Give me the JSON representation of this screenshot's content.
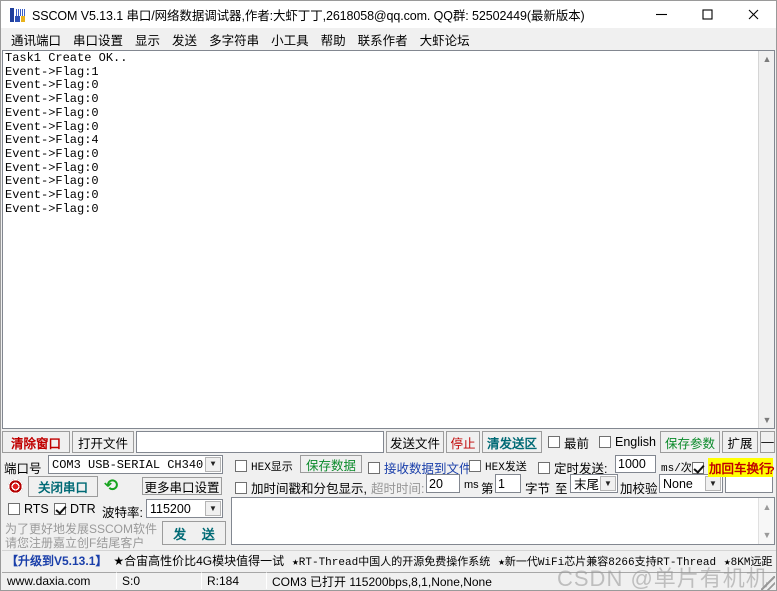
{
  "window": {
    "title": "SSCOM V5.13.1 串口/网络数据调试器,作者:大虾丁丁,2618058@qq.com. QQ群: 52502449(最新版本)",
    "icon": "sscom-app-icon",
    "minimize": "—",
    "maximize": "□",
    "close": "✕"
  },
  "menu": {
    "items": [
      {
        "label": "通讯端口"
      },
      {
        "label": "串口设置"
      },
      {
        "label": "显示"
      },
      {
        "label": "发送"
      },
      {
        "label": "多字符串"
      },
      {
        "label": "小工具"
      },
      {
        "label": "帮助"
      },
      {
        "label": "联系作者"
      },
      {
        "label": "大虾论坛"
      }
    ]
  },
  "receive": {
    "text": "Task1 Create OK..\nEvent->Flag:1\nEvent->Flag:0\nEvent->Flag:0\nEvent->Flag:0\nEvent->Flag:0\nEvent->Flag:4\nEvent->Flag:0\nEvent->Flag:0\nEvent->Flag:0\nEvent->Flag:0\nEvent->Flag:0",
    "scroll_up_icon": "chevron-up-icon",
    "scroll_down_icon": "chevron-down-icon"
  },
  "toolbar": {
    "clear_window": "清除窗口",
    "open_file": "打开文件",
    "file_path_value": "",
    "send_file": "发送文件",
    "stop": "停止",
    "clear_send": "清发送区",
    "topmost_label": "最前",
    "topmost_checked": false,
    "english_label": "English",
    "english_checked": false,
    "save_params": "保存参数",
    "extend": "扩展",
    "collapse": "—"
  },
  "settings": {
    "port_label": "端口号",
    "port_value": "COM3 USB-SERIAL CH340",
    "close_port_button": "关闭串口",
    "refresh_icon": "refresh-icon",
    "led_icon": "port-status-led",
    "more_port_settings": "更多串口设置",
    "rts_label": "RTS",
    "rts_checked": false,
    "dtr_label": "DTR",
    "dtr_checked": true,
    "baud_label": "波特率:",
    "baud_value": "115200",
    "hex_display_label": "HEX显示",
    "hex_display_checked": false,
    "save_data_button": "保存数据",
    "timestamp_label": "加时间戳和分包显示,",
    "timestamp_checked": false,
    "timeout_label": "超时时间:",
    "timeout_value": "20",
    "timeout_unit": "ms",
    "recv_to_file_label": "接收数据到文件",
    "recv_to_file_checked": false,
    "byte_prefix": "第",
    "byte_index": "1",
    "byte_suffix": "字节",
    "to_label": "至",
    "to_value": "末尾",
    "checksum_label": "加校验",
    "checksum_value": "None",
    "checksum_extra_value": "",
    "hex_send_label": "HEX发送",
    "hex_send_checked": false,
    "timed_send_label": "定时发送:",
    "timed_send_checked": false,
    "interval_value": "1000",
    "interval_unit": "ms/次",
    "crlf_label": "加回车换行",
    "crlf_checked": true,
    "help_marker": "?",
    "ad_line1": "为了更好地发展SSCOM软件",
    "ad_line2": "请您注册嘉立创F结尾客户",
    "send_button": "发 送",
    "send_text_value": ""
  },
  "banner": {
    "upgrade": "【升级到V5.13.1】",
    "items": [
      "★合宙高性价比4G模块值得一试",
      "★RT-Thread中国人的开源免费操作系统",
      "★新一代WiFi芯片兼容8266支持RT-Thread",
      "★8KM远距"
    ]
  },
  "status": {
    "website": "www.daxia.com",
    "sent": "S:0",
    "received": "R:184",
    "connection": "COM3 已打开  115200bps,8,1,None,None"
  },
  "watermark": "CSDN @单片有机机",
  "colors": {
    "accent_red": "#c00000",
    "accent_green": "#0a8a2a",
    "accent_teal": "#006a75",
    "accent_blue": "#1a3faa",
    "highlight_yellow": "#ffff00"
  }
}
